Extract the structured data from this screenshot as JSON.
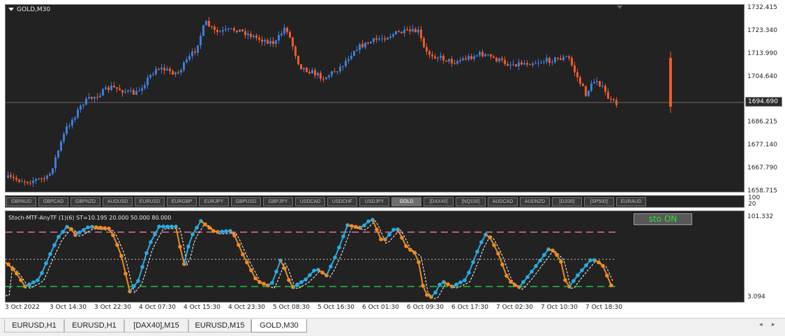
{
  "chart": {
    "title": "GOLD,M30",
    "current_price": "1694.690",
    "price_ticks": [
      "1732.415",
      "1723.340",
      "1713.990",
      "1704.640",
      "1694.690",
      "1686.215",
      "1677.140",
      "1667.790",
      "1658.715"
    ],
    "colors": {
      "bg": "#222222",
      "bull": "#3d7ddb",
      "bear": "#f05a28",
      "crosshair": "#6f6f6f"
    }
  },
  "symbols": {
    "items": [
      "GBPAUD",
      "GBPCAD",
      "GBPNZD",
      "AUDUSD",
      "EURUSD",
      "EURGBP",
      "EURJPY",
      "GBPUSD",
      "GBPJPY",
      "USDCAD",
      "USDCHF",
      "USDJPY",
      "GOLD",
      "[DAX40]",
      "[NQ100]",
      "AUDCAD",
      "AUDNZD",
      "[DJI30]",
      "[SP500]",
      "EURAUD"
    ],
    "active": "GOLD"
  },
  "indicator": {
    "title": "Stoch-MTF-AnyTF (1)(6) ST=10.195 20.000 50.000 80.000",
    "button_label": "sto ON",
    "axis_top": "101.332",
    "axis_bottom": "3.094",
    "separator_top": "100",
    "separator_bottom": "20",
    "colors": {
      "up": "#29abe2",
      "down": "#f28b1c",
      "level_high": "#e0719a",
      "level_low": "#22c04a",
      "signal": "#ffffff"
    }
  },
  "time_axis": [
    "3 Oct 2022",
    "3 Oct 14:30",
    "3 Oct 22:30",
    "4 Oct 07:30",
    "4 Oct 15:30",
    "4 Oct 23:30",
    "5 Oct 08:30",
    "5 Oct 16:30",
    "6 Oct 01:30",
    "6 Oct 09:30",
    "6 Oct 17:30",
    "7 Oct 02:30",
    "7 Oct 10:30",
    "7 Oct 18:30"
  ],
  "tabs": {
    "items": [
      "EURUSD,H1",
      "EURUSD,H1",
      "[DAX40],M15",
      "EURUSD,M15",
      "GOLD,M30"
    ],
    "active": "GOLD,M30"
  },
  "scroll": {
    "left": "◂",
    "right": "▸"
  }
}
